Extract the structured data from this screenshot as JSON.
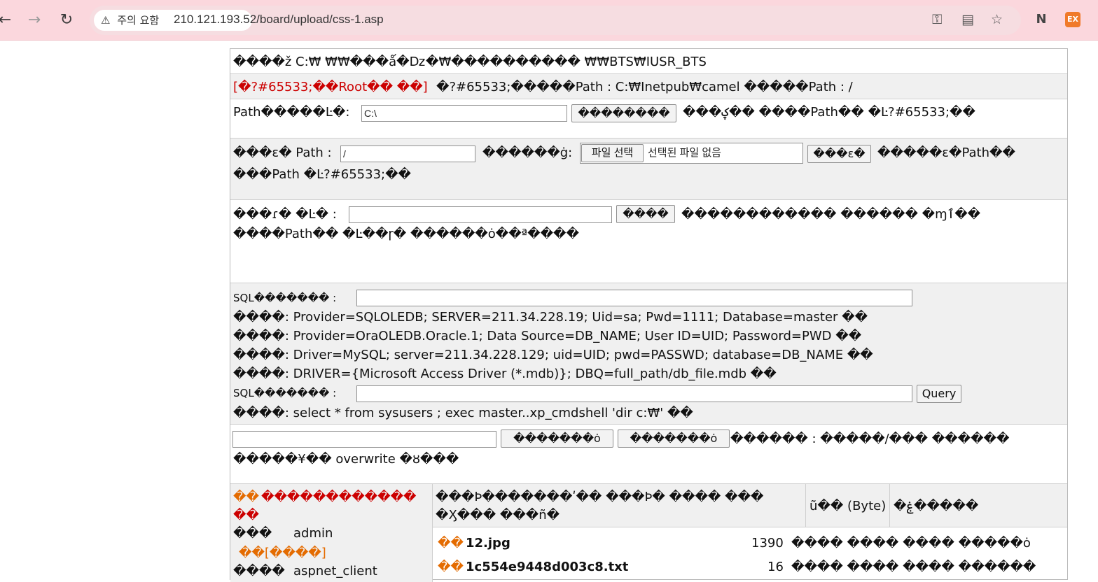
{
  "browser": {
    "security_label": "주의 요함",
    "url": "210.121.193.52/board/upload/css-1.asp",
    "ext_label": "EX"
  },
  "rows": {
    "row1": "����ž C:₩     ₩₩���ǻ�ǲ�₩���������� ₩₩BTS₩IUSR_BTS",
    "row2_red": "[�?#65533;��Root��  ��]",
    "row2_rest": "�?#65533;�����Path : C:₩Inetpub₩camel     �����Path : /",
    "row3_label": "Path�����Ŀ�:",
    "row3_value": "C:\\",
    "row3_button": "��������",
    "row3_after": "���ؼ��  ����Path��  �Ŀ?#65533;��",
    "row4_label": "���ε�  Path :",
    "row4_value": "/",
    "row4_label2": "������ġ:",
    "row4_file_button": "파일 선택",
    "row4_file_text": "선택된 파일 없음",
    "row4_button": "���ε�",
    "row4_after": "�����ε�Path��",
    "row4_line2": "���Path  �Ŀ?#65533;��",
    "row5_label": "���ɾ�  �Ŀ� :",
    "row5_button": "����",
    "row5_after": "������������  ������  �ɱٱ��",
    "row5_line2": "����Path��  �Ŀ��ɼ�  ������ȯ��ª����",
    "sql_label": "SQL������� :",
    "sql_lines": [
      "����: Provider=SQLOLEDB; SERVER=211.34.228.19; Uid=sa; Pwd=1111; Database=master ��",
      "����: Provider=OraOLEDB.Oracle.1; Data Source=DB_NAME; User ID=UID; Password=PWD ��",
      "����: Driver=MySQL; server=211.34.228.129; uid=UID; pwd=PASSWD; database=DB_NAME ��",
      "����: DRIVER={Microsoft Access Driver (*.mdb)}; DBQ=full_path/db_file.mdb ��"
    ],
    "sql_label2": "SQL������� :",
    "query_button": "Query",
    "sql_example": "����: select * from sysusers ; exec master..xp_cmdshell 'dir c:₩' ��",
    "row7_button1": "�������ȯ",
    "row7_button2": "�������ȯ",
    "row7_after": "������ : �����/���  ������",
    "row7_line2": "�����¥��  overwrite  �ȣ���"
  },
  "files": {
    "folder_header_a": "��",
    "folder_header_b": "������������",
    "folder_header_line2": "��",
    "folders": [
      {
        "icon": "���",
        "name": "admin"
      },
      {
        "icon": "��[����]",
        "name": ""
      },
      {
        "icon": "����",
        "name": "aspnet_client"
      }
    ],
    "col_name_header": "���Þ�������ʹ��  ���Þ�  ����  ���",
    "col_name_header2": "�Ӽ���  ���ñ�",
    "col_size_header": "ũ��  (Byte)",
    "col_date_header": "�ۼ�����",
    "rows": [
      {
        "icon": "��",
        "name": "12.jpg",
        "size": "1390",
        "attrs": "����  ����  ����  �����ȯ"
      },
      {
        "icon": "��",
        "name": "1c554e9448d003c8.txt",
        "size": "16",
        "attrs": "����  ����  ����  ������"
      }
    ]
  }
}
